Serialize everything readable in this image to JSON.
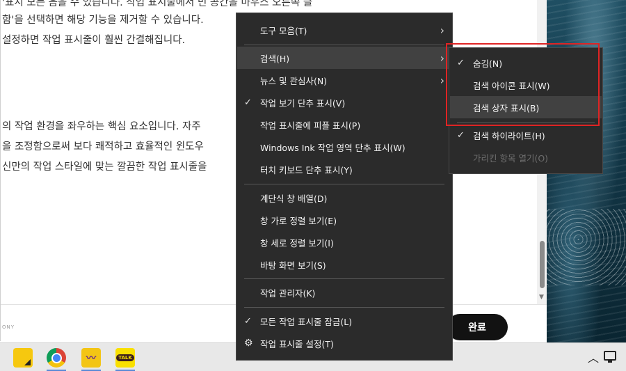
{
  "document": {
    "lines": [
      "'표시 모든 음을 수 있습니다. 작업 표시줄에서 빈 공간을 마우스 오른쪽 클",
      "함'을 선택하면 해당 기능을 제거할 수 있습니다.",
      "설정하면 작업 표시줄이 훨씬 간결해집니다.",
      "의 작업 환경을 좌우하는 핵심 요소입니다. 자주",
      "을 조정함으로써 보다 쾌적하고 효율적인 윈도우",
      "신만의 작업 스타일에 맞는 깔끔한 작업 표시줄을"
    ],
    "footer_tag": "ONY",
    "done_button": "완료"
  },
  "context_menu": {
    "items": [
      {
        "label": "도구 모음(T)",
        "submenu": true
      },
      {
        "label": "검색(H)",
        "submenu": true,
        "highlighted": true
      },
      {
        "label": "뉴스 및 관심사(N)",
        "submenu": true
      },
      {
        "label": "작업 보기 단추 표시(V)",
        "checked": true
      },
      {
        "label": "작업 표시줄에 피플 표시(P)"
      },
      {
        "label": "Windows Ink 작업 영역 단추 표시(W)"
      },
      {
        "label": "터치 키보드 단추 표시(Y)"
      },
      {
        "label": "계단식 창 배열(D)"
      },
      {
        "label": "창 가로 정렬 보기(E)"
      },
      {
        "label": "창 세로 정렬 보기(I)"
      },
      {
        "label": "바탕 화면 보기(S)"
      },
      {
        "label": "작업 관리자(K)"
      },
      {
        "label": "모든 작업 표시줄 잠금(L)",
        "checked": true
      },
      {
        "label": "작업 표시줄 설정(T)",
        "icon": "gear-icon"
      }
    ]
  },
  "search_submenu": {
    "items": [
      {
        "label": "숨김(N)",
        "checked": true
      },
      {
        "label": "검색 아이콘 표시(W)"
      },
      {
        "label": "검색 상자 표시(B)",
        "highlighted": true
      },
      {
        "label": "검색 하이라이트(H)",
        "checked": true
      },
      {
        "label": "가리킨 항목 열기(O)",
        "disabled": true
      }
    ]
  },
  "taskbar": {
    "apps": [
      "sticky-notes-icon",
      "chrome-icon",
      "wave-app-icon",
      "kakaotalk-icon"
    ],
    "kakaotalk_label": "TALK"
  },
  "colors": {
    "menu_bg": "#2b2b2b",
    "menu_hover": "#414141",
    "highlight_box": "#e02424",
    "done_button_bg": "#121212"
  }
}
